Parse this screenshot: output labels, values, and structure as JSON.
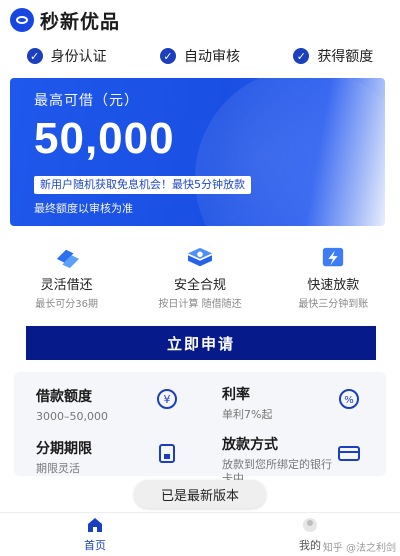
{
  "header": {
    "app_title": "秒新优品",
    "logo_icon": "app-logo-icon"
  },
  "features": [
    {
      "label": "身份认证",
      "icon": "check-circle-icon"
    },
    {
      "label": "自动审核",
      "icon": "check-circle-icon"
    },
    {
      "label": "获得额度",
      "icon": "check-circle-icon"
    }
  ],
  "banner": {
    "label": "最高可借（元）",
    "amount": "50,000",
    "promo": "新用户随机获取免息机会！最快5分钟放款",
    "note": "最终额度以审核为准"
  },
  "perks": [
    {
      "title": "灵活借还",
      "subtitle": "最长可分36期",
      "icon": "flexible-repay-icon"
    },
    {
      "title": "安全合规",
      "subtitle": "按日计算 随借随还",
      "icon": "security-compliance-icon"
    },
    {
      "title": "快速放款",
      "subtitle": "最快三分钟到账",
      "icon": "fast-disburse-icon"
    }
  ],
  "apply_button": {
    "label": "立即申请"
  },
  "info": {
    "loan_amount": {
      "title": "借款额度",
      "value": "3000–50,000",
      "icon": "yen-exchange-icon"
    },
    "rate": {
      "title": "利率",
      "value": "单利7%起",
      "icon": "percent-icon"
    },
    "term": {
      "title": "分期期限",
      "value": "期限灵活",
      "icon": "calendar-icon"
    },
    "disbursement": {
      "title": "放款方式",
      "value": "放款到您所绑定的银行卡中",
      "icon": "bank-card-icon"
    }
  },
  "toast": {
    "text": "已是最新版本"
  },
  "bottom_nav": {
    "home": {
      "label": "首页",
      "icon": "home-icon"
    },
    "mine": {
      "label": "我的",
      "icon": "user-icon"
    },
    "watermark": "知乎 @法之利剑"
  },
  "colors": {
    "primary": "#1c3fbf",
    "button": "#061a8a",
    "banner_start": "#1f58ec"
  }
}
